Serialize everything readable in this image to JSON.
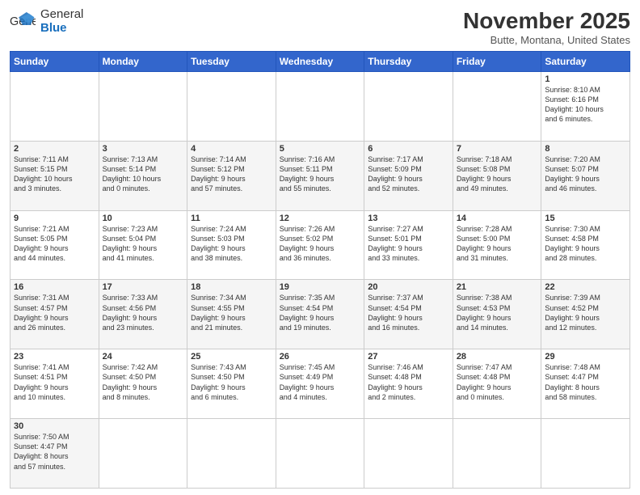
{
  "logo": {
    "text_general": "General",
    "text_blue": "Blue"
  },
  "title": "November 2025",
  "location": "Butte, Montana, United States",
  "days_of_week": [
    "Sunday",
    "Monday",
    "Tuesday",
    "Wednesday",
    "Thursday",
    "Friday",
    "Saturday"
  ],
  "weeks": [
    [
      {
        "day": "",
        "info": ""
      },
      {
        "day": "",
        "info": ""
      },
      {
        "day": "",
        "info": ""
      },
      {
        "day": "",
        "info": ""
      },
      {
        "day": "",
        "info": ""
      },
      {
        "day": "",
        "info": ""
      },
      {
        "day": "1",
        "info": "Sunrise: 8:10 AM\nSunset: 6:16 PM\nDaylight: 10 hours\nand 6 minutes."
      }
    ],
    [
      {
        "day": "2",
        "info": "Sunrise: 7:11 AM\nSunset: 5:15 PM\nDaylight: 10 hours\nand 3 minutes."
      },
      {
        "day": "3",
        "info": "Sunrise: 7:13 AM\nSunset: 5:14 PM\nDaylight: 10 hours\nand 0 minutes."
      },
      {
        "day": "4",
        "info": "Sunrise: 7:14 AM\nSunset: 5:12 PM\nDaylight: 9 hours\nand 57 minutes."
      },
      {
        "day": "5",
        "info": "Sunrise: 7:16 AM\nSunset: 5:11 PM\nDaylight: 9 hours\nand 55 minutes."
      },
      {
        "day": "6",
        "info": "Sunrise: 7:17 AM\nSunset: 5:09 PM\nDaylight: 9 hours\nand 52 minutes."
      },
      {
        "day": "7",
        "info": "Sunrise: 7:18 AM\nSunset: 5:08 PM\nDaylight: 9 hours\nand 49 minutes."
      },
      {
        "day": "8",
        "info": "Sunrise: 7:20 AM\nSunset: 5:07 PM\nDaylight: 9 hours\nand 46 minutes."
      }
    ],
    [
      {
        "day": "9",
        "info": "Sunrise: 7:21 AM\nSunset: 5:05 PM\nDaylight: 9 hours\nand 44 minutes."
      },
      {
        "day": "10",
        "info": "Sunrise: 7:23 AM\nSunset: 5:04 PM\nDaylight: 9 hours\nand 41 minutes."
      },
      {
        "day": "11",
        "info": "Sunrise: 7:24 AM\nSunset: 5:03 PM\nDaylight: 9 hours\nand 38 minutes."
      },
      {
        "day": "12",
        "info": "Sunrise: 7:26 AM\nSunset: 5:02 PM\nDaylight: 9 hours\nand 36 minutes."
      },
      {
        "day": "13",
        "info": "Sunrise: 7:27 AM\nSunset: 5:01 PM\nDaylight: 9 hours\nand 33 minutes."
      },
      {
        "day": "14",
        "info": "Sunrise: 7:28 AM\nSunset: 5:00 PM\nDaylight: 9 hours\nand 31 minutes."
      },
      {
        "day": "15",
        "info": "Sunrise: 7:30 AM\nSunset: 4:58 PM\nDaylight: 9 hours\nand 28 minutes."
      }
    ],
    [
      {
        "day": "16",
        "info": "Sunrise: 7:31 AM\nSunset: 4:57 PM\nDaylight: 9 hours\nand 26 minutes."
      },
      {
        "day": "17",
        "info": "Sunrise: 7:33 AM\nSunset: 4:56 PM\nDaylight: 9 hours\nand 23 minutes."
      },
      {
        "day": "18",
        "info": "Sunrise: 7:34 AM\nSunset: 4:55 PM\nDaylight: 9 hours\nand 21 minutes."
      },
      {
        "day": "19",
        "info": "Sunrise: 7:35 AM\nSunset: 4:54 PM\nDaylight: 9 hours\nand 19 minutes."
      },
      {
        "day": "20",
        "info": "Sunrise: 7:37 AM\nSunset: 4:54 PM\nDaylight: 9 hours\nand 16 minutes."
      },
      {
        "day": "21",
        "info": "Sunrise: 7:38 AM\nSunset: 4:53 PM\nDaylight: 9 hours\nand 14 minutes."
      },
      {
        "day": "22",
        "info": "Sunrise: 7:39 AM\nSunset: 4:52 PM\nDaylight: 9 hours\nand 12 minutes."
      }
    ],
    [
      {
        "day": "23",
        "info": "Sunrise: 7:41 AM\nSunset: 4:51 PM\nDaylight: 9 hours\nand 10 minutes."
      },
      {
        "day": "24",
        "info": "Sunrise: 7:42 AM\nSunset: 4:50 PM\nDaylight: 9 hours\nand 8 minutes."
      },
      {
        "day": "25",
        "info": "Sunrise: 7:43 AM\nSunset: 4:50 PM\nDaylight: 9 hours\nand 6 minutes."
      },
      {
        "day": "26",
        "info": "Sunrise: 7:45 AM\nSunset: 4:49 PM\nDaylight: 9 hours\nand 4 minutes."
      },
      {
        "day": "27",
        "info": "Sunrise: 7:46 AM\nSunset: 4:48 PM\nDaylight: 9 hours\nand 2 minutes."
      },
      {
        "day": "28",
        "info": "Sunrise: 7:47 AM\nSunset: 4:48 PM\nDaylight: 9 hours\nand 0 minutes."
      },
      {
        "day": "29",
        "info": "Sunrise: 7:48 AM\nSunset: 4:47 PM\nDaylight: 8 hours\nand 58 minutes."
      }
    ],
    [
      {
        "day": "30",
        "info": "Sunrise: 7:50 AM\nSunset: 4:47 PM\nDaylight: 8 hours\nand 57 minutes."
      },
      {
        "day": "",
        "info": ""
      },
      {
        "day": "",
        "info": ""
      },
      {
        "day": "",
        "info": ""
      },
      {
        "day": "",
        "info": ""
      },
      {
        "day": "",
        "info": ""
      },
      {
        "day": "",
        "info": ""
      }
    ]
  ]
}
